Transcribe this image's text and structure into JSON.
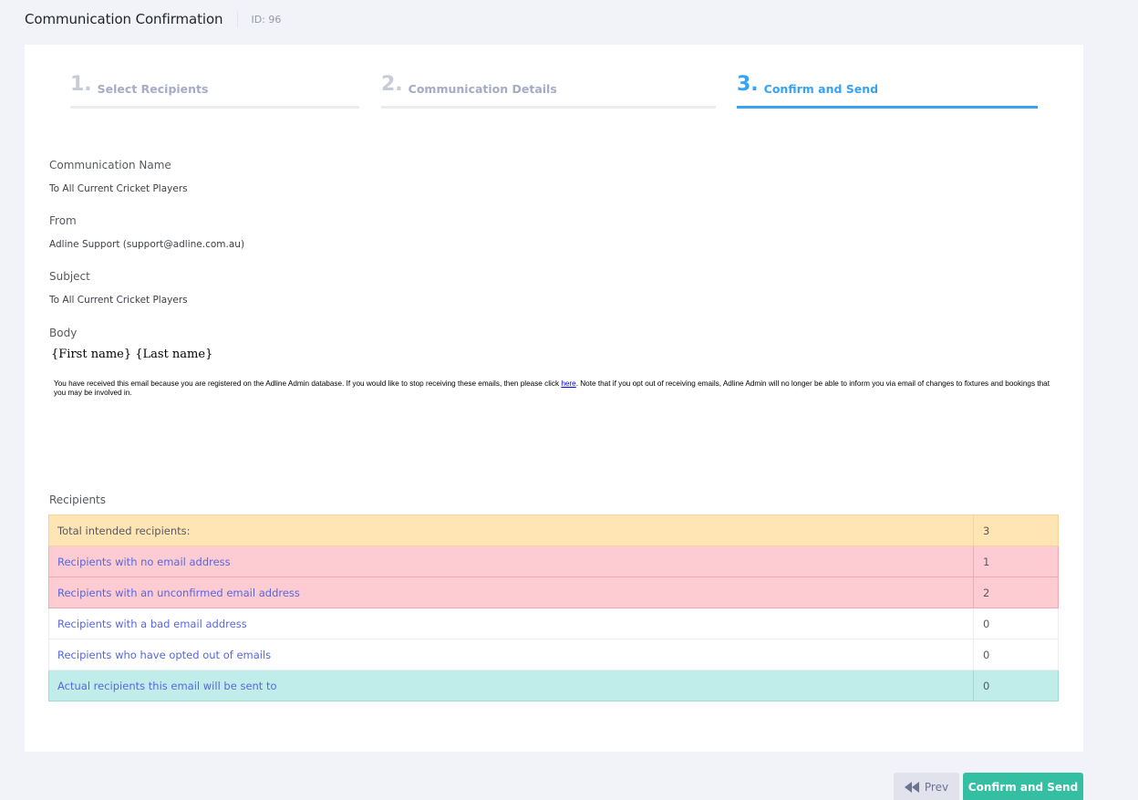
{
  "header": {
    "title": "Communication Confirmation",
    "id_label": "ID: 96"
  },
  "steps": [
    {
      "num": "1.",
      "label": "Select Recipients"
    },
    {
      "num": "2.",
      "label": "Communication Details"
    },
    {
      "num": "3.",
      "label": "Confirm and Send"
    }
  ],
  "fields": {
    "name_label": "Communication Name",
    "name_value": "To All Current Cricket Players",
    "from_label": "From",
    "from_value": "Adline Support (support@adline.com.au)",
    "subject_label": "Subject",
    "subject_value": "To All Current Cricket Players",
    "body_label": "Body"
  },
  "body": {
    "greeting": "{First name} {Last name}",
    "footer_before": "You have received this email because you are registered on the Adline Admin database. If you would like to stop receiving these emails, then please click ",
    "footer_link": "here",
    "footer_after": ". Note that if you opt out of receiving emails, Adline Admin will no longer be able to inform you via email of changes to fixtures and bookings that you may be involved in."
  },
  "recipients": {
    "heading": "Recipients",
    "rows": [
      {
        "label": "Total intended recipients:",
        "value": "3"
      },
      {
        "label": "Recipients with no email address",
        "value": "1"
      },
      {
        "label": "Recipients with an unconfirmed email address",
        "value": "2"
      },
      {
        "label": "Recipients with a bad email address",
        "value": "0"
      },
      {
        "label": "Recipients who have opted out of emails",
        "value": "0"
      },
      {
        "label": "Actual recipients this email will be sent to",
        "value": "0"
      }
    ]
  },
  "buttons": {
    "prev": "Prev",
    "confirm": "Confirm and Send"
  }
}
